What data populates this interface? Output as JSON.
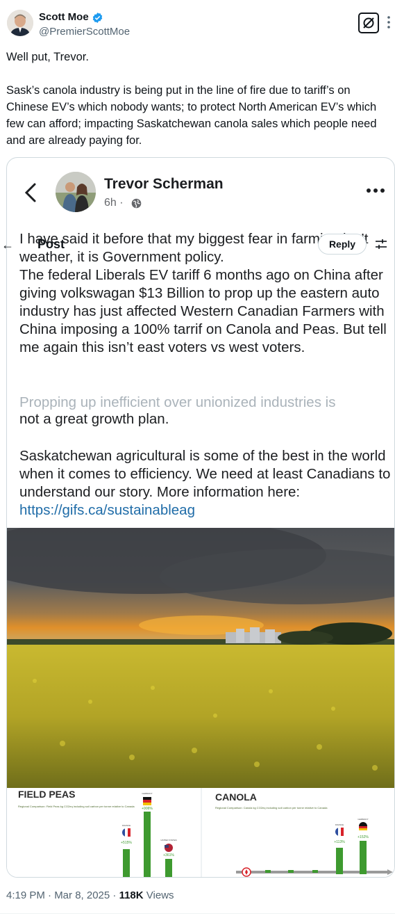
{
  "author": {
    "name": "Scott Moe",
    "handle": "@PremierScottMoe",
    "verified": true
  },
  "tweet": {
    "line1": "Well put, Trevor.",
    "line2": "Sask’s canola industry is being put in the line of fire due to tariff’s on Chinese EV’s which nobody wants; to protect North American EV’s which few can afford; impacting Saskatchewan canola sales which people need and are already paying for."
  },
  "embedded_post": {
    "name": "Trevor Scherman",
    "time": "6h ·",
    "paragraph1": "I have said it before that my biggest fear in farming isn’t weather, it is Government policy.",
    "paragraph2": "The federal Liberals EV tariff 6 months ago on China after giving volkswagan $13 Billion to prop up the eastern auto industry has just affected Western Canadian Farmers with China imposing a 100% tarrif on Canola and Peas. But tell me again this isn’t east voters vs west voters.",
    "partial_line": "Propping up inefficient over unionized industries is",
    "partial_line2": "not a great growth plan.",
    "paragraph4": "Saskatchewan agricultural is some of the best in the world when it comes to efficiency. We need at least Canadians to understand our story. More information here: ",
    "link": "https://gifs.ca/sustainableag"
  },
  "overlay_bar": {
    "back_arrow": "←",
    "title": "Post",
    "reply_label": "Reply"
  },
  "infographic": {
    "left_title": "FIELD PEAS",
    "left_subtitle": "Regional Comparison: Field Peas kg CO2eq including soil carbon per tonne relative to Canada",
    "right_title": "CANOLA",
    "right_subtitle": "Regional Comparison: Canola kg CO2eq including soil carbon per tonne relative to Canada",
    "left_bars": [
      {
        "label": "FRANCE",
        "value": "+515%"
      },
      {
        "label": "GERMANY",
        "value": "+906%"
      },
      {
        "label": "UNITED STATES",
        "value": "+361%"
      }
    ],
    "right_bars": [
      {
        "label": "FRANCE",
        "value": "+113%"
      },
      {
        "label": "GERMANY",
        "value": "+152%"
      }
    ]
  },
  "meta": {
    "time": "4:19 PM · Mar 8, 2025 · ",
    "views_count": "118K",
    "views_label": " Views"
  },
  "colors": {
    "text": "#0f1419",
    "secondary": "#536471",
    "link": "#1f6ca8",
    "verified": "#1d9bf0",
    "canola": "#d8c92a",
    "bar_green": "#3e9a2f"
  }
}
